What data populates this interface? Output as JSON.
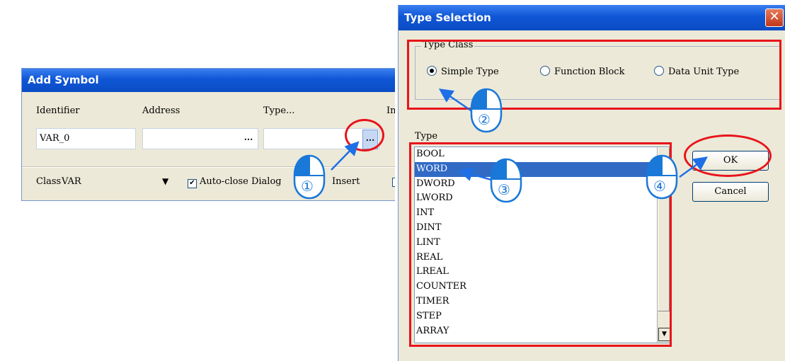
{
  "add_symbol": {
    "title": "Add Symbol",
    "labels": {
      "identifier": "Identifier",
      "address": "Address",
      "type": "Type...",
      "initial": "In"
    },
    "identifier_value": "VAR_0",
    "address_value": "",
    "type_value": "",
    "ellipsis": "...",
    "class_label": "Class",
    "class_value": "VAR",
    "auto_close_label": "Auto-close Dialog",
    "insert_label": "Insert"
  },
  "type_selection": {
    "title": "Type Selection",
    "close_glyph": "✕",
    "type_class_legend": "Type Class",
    "radio_options": [
      "Simple Type",
      "Function Block",
      "Data Unit Type"
    ],
    "selected_radio": "Simple Type",
    "type_label": "Type",
    "types": [
      "BOOL",
      "WORD",
      "DWORD",
      "LWORD",
      "INT",
      "DINT",
      "LINT",
      "REAL",
      "LREAL",
      "COUNTER",
      "TIMER",
      "STEP",
      "ARRAY"
    ],
    "selected_type": "WORD",
    "ok_label": "OK",
    "cancel_label": "Cancel"
  },
  "annotations": {
    "step_numbers": [
      "①",
      "②",
      "③",
      "④"
    ],
    "highlight_color": "#e8141b",
    "arrow_color": "#1e6fe6",
    "callout_color": "#1a78d8"
  }
}
